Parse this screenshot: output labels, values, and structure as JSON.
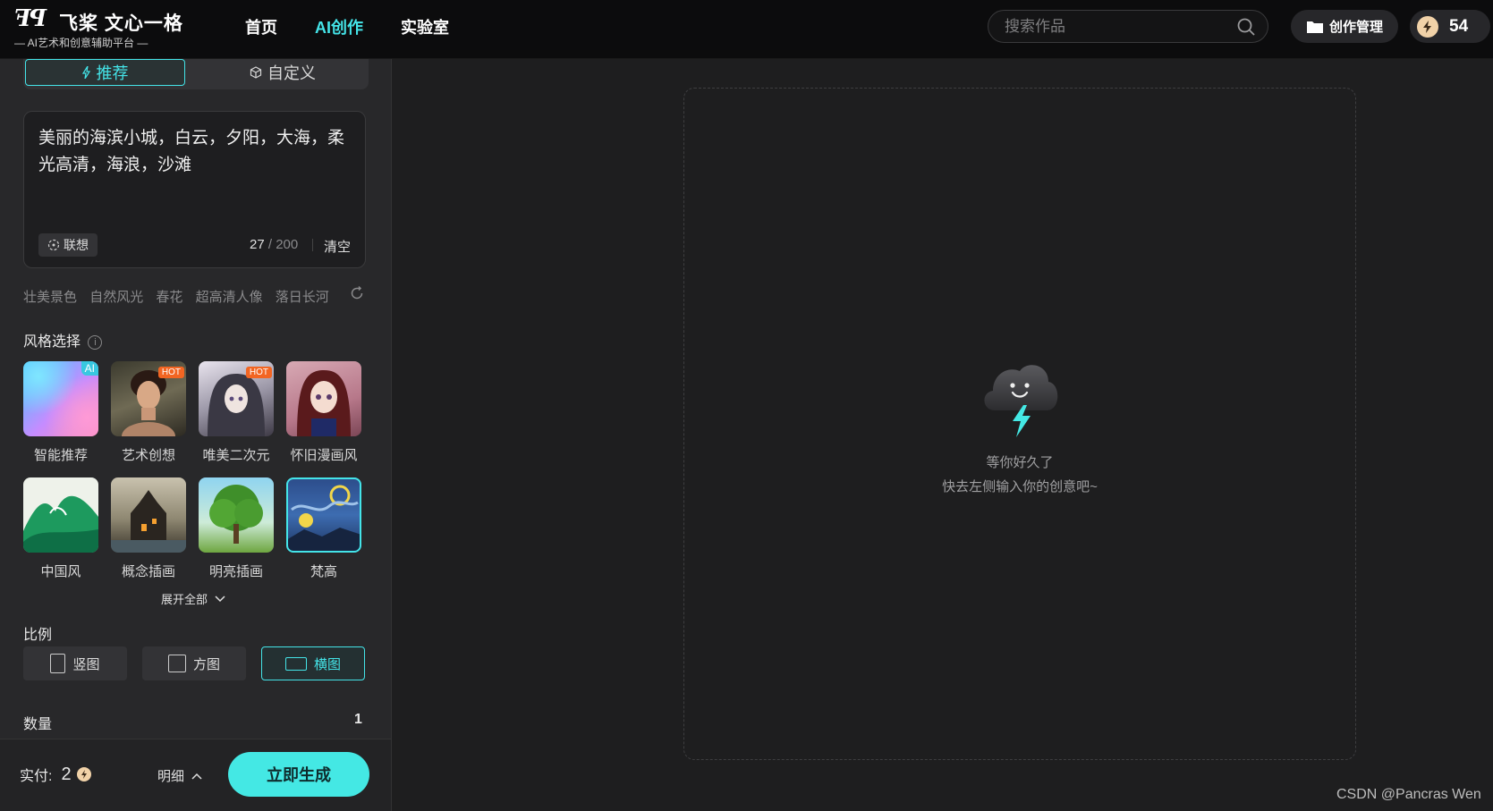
{
  "header": {
    "logo_mark": "ꟻꟼ",
    "logo_name": "飞桨 文心一格",
    "logo_sub": "— AI艺术和创意辅助平台 —",
    "nav": [
      "首页",
      "AI创作",
      "实验室"
    ],
    "active_nav": "AI创作",
    "search_placeholder": "搜索作品",
    "manage_label": "创作管理",
    "points": "54"
  },
  "mode_tabs": {
    "recommend": "推荐",
    "custom": "自定义"
  },
  "prompt": {
    "text": "美丽的海滨小城，白云，夕阳，大海，柔光高清，海浪，沙滩",
    "assoc_label": "联想",
    "count_current": "27",
    "count_max": "/ 200",
    "clear_label": "清空"
  },
  "tags": [
    "壮美景色",
    "自然风光",
    "春花",
    "超高清人像",
    "落日长河"
  ],
  "style_section": {
    "title": "风格选择",
    "info": "i",
    "items": [
      {
        "label": "智能推荐",
        "badge": "AI"
      },
      {
        "label": "艺术创想",
        "badge": "HOT"
      },
      {
        "label": "唯美二次元",
        "badge": "HOT"
      },
      {
        "label": "怀旧漫画风",
        "badge": ""
      },
      {
        "label": "中国风",
        "badge": ""
      },
      {
        "label": "概念插画",
        "badge": ""
      },
      {
        "label": "明亮插画",
        "badge": ""
      },
      {
        "label": "梵高",
        "badge": ""
      }
    ],
    "selected": "梵高",
    "expand_label": "展开全部"
  },
  "ratio_section": {
    "title": "比例",
    "options": [
      "竖图",
      "方图",
      "横图"
    ],
    "selected": "横图"
  },
  "quantity": {
    "title": "数量",
    "value": "1"
  },
  "bottom": {
    "pay_label": "实付:",
    "pay_value": "2",
    "detail_label": "明细",
    "generate_label": "立即生成"
  },
  "empty_state": {
    "line1": "等你好久了",
    "line2": "快去左侧输入你的创意吧~"
  },
  "watermark": "CSDN @Pancras Wen",
  "colors": {
    "accent": "#44e4e8",
    "hot": "#f26522"
  }
}
